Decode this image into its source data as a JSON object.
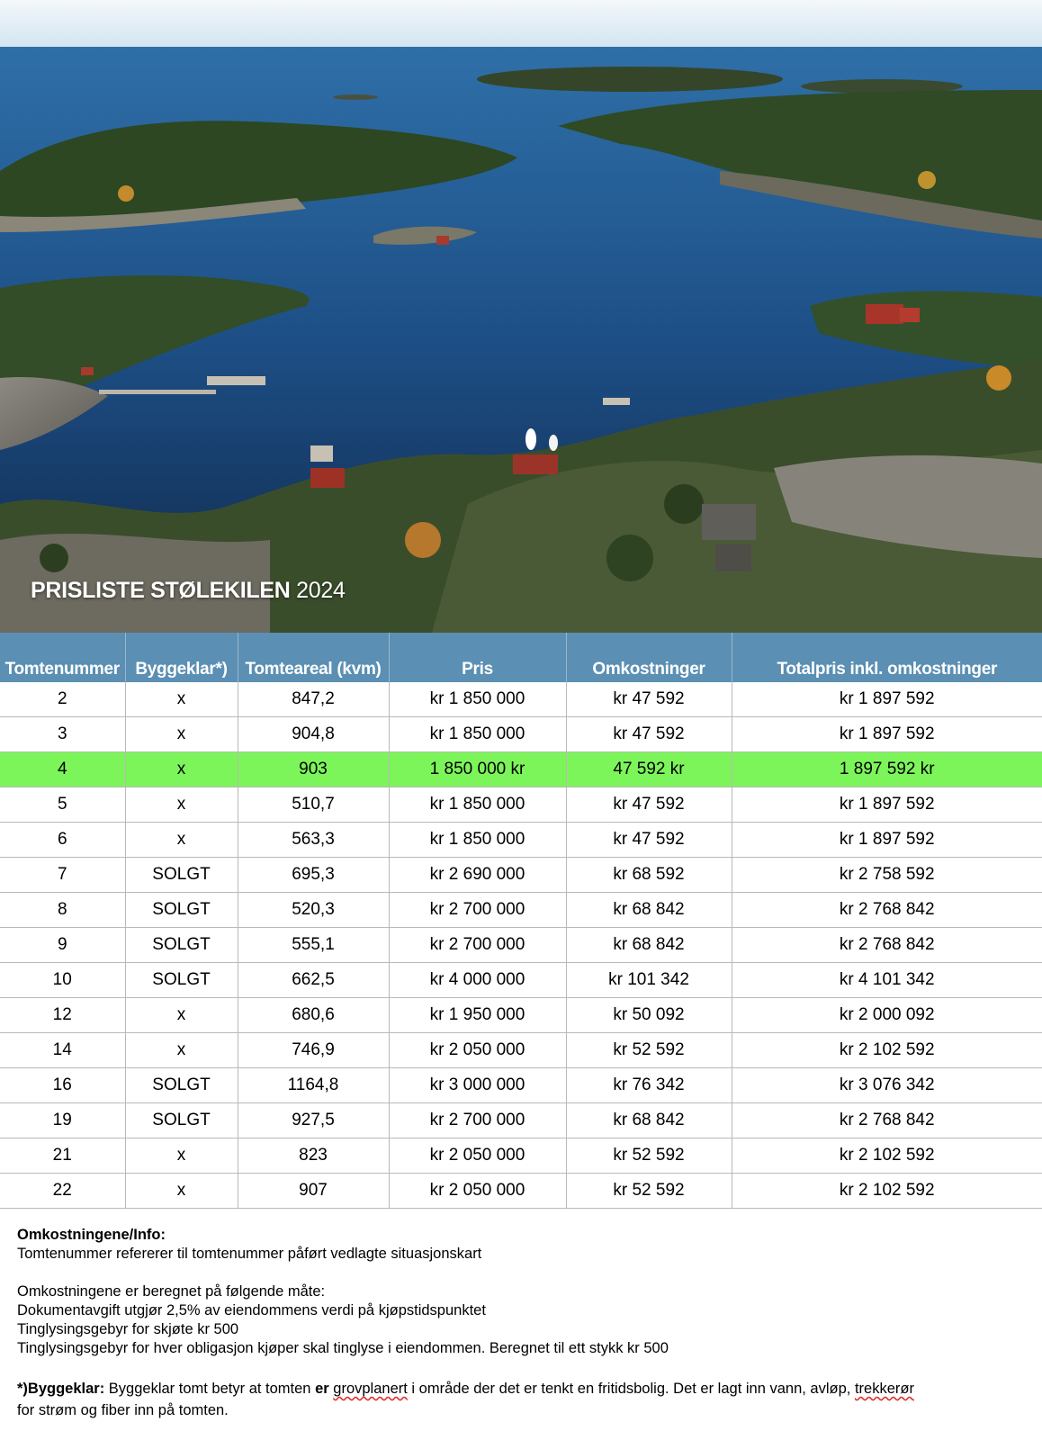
{
  "hero": {
    "title_bold": "PRISLISTE STØLEKILEN",
    "title_year": "2024"
  },
  "table": {
    "headers": [
      "Tomtenummer",
      "Byggeklar*)",
      "Tomteareal (kvm)",
      "Pris",
      "Omkostninger",
      "Totalpris inkl. omkostninger"
    ],
    "rows": [
      [
        "2",
        "x",
        "847,2",
        "kr 1 850 000",
        "kr 47 592",
        "kr 1 897 592"
      ],
      [
        "3",
        "x",
        "904,8",
        "kr 1 850 000",
        "kr 47 592",
        "kr 1 897 592"
      ],
      [
        "4",
        "x",
        "903",
        "1 850 000 kr",
        "47 592 kr",
        "1 897 592 kr"
      ],
      [
        "5",
        "x",
        "510,7",
        "kr 1 850 000",
        "kr 47 592",
        "kr 1 897 592"
      ],
      [
        "6",
        "x",
        "563,3",
        "kr 1 850 000",
        "kr 47 592",
        "kr 1 897 592"
      ],
      [
        "7",
        "SOLGT",
        "695,3",
        "kr 2 690 000",
        "kr 68 592",
        "kr 2 758 592"
      ],
      [
        "8",
        "SOLGT",
        "520,3",
        "kr 2 700 000",
        "kr 68 842",
        "kr 2 768 842"
      ],
      [
        "9",
        "SOLGT",
        "555,1",
        "kr 2 700 000",
        "kr 68 842",
        "kr 2 768 842"
      ],
      [
        "10",
        "SOLGT",
        "662,5",
        "kr 4 000 000",
        "kr 101 342",
        "kr 4 101 342"
      ],
      [
        "12",
        "x",
        "680,6",
        "kr 1 950 000",
        "kr 50 092",
        "kr 2 000 092"
      ],
      [
        "14",
        "x",
        "746,9",
        "kr 2 050 000",
        "kr 52 592",
        "kr 2 102 592"
      ],
      [
        "16",
        "SOLGT",
        "1164,8",
        "kr 3 000 000",
        "kr 76 342",
        "kr 3 076 342"
      ],
      [
        "19",
        "SOLGT",
        "927,5",
        "kr 2 700 000",
        "kr 68 842",
        "kr 2 768 842"
      ],
      [
        "21",
        "x",
        "823",
        "kr 2 050 000",
        "kr 52 592",
        "kr 2 102 592"
      ],
      [
        "22",
        "x",
        "907",
        "kr 2 050 000",
        "kr 52 592",
        "kr 2 102 592"
      ]
    ],
    "highlight_row": 2,
    "colors": {
      "header_bg": "#5b8fb3",
      "highlight_bg": "#7cf55a"
    }
  },
  "notes": {
    "heading": "Omkostningene/Info:",
    "line1": "Tomtenummer refererer til tomtenummer påført vedlagte situasjonskart",
    "calc_intro": "Omkostningene er beregnet på følgende måte:",
    "calc_lines": [
      "Dokumentavgift utgjør 2,5% av eiendommens verdi på kjøpstidspunktet",
      "Tinglysingsgebyr for skjøte kr 500",
      "Tinglysingsgebyr for hver obligasjon kjøper skal tinglyse i eiendommen. Beregnet til ett stykk kr 500"
    ],
    "byggeklar_label": "*)Byggeklar:",
    "byggeklar_a": "Byggeklar tomt betyr at tomten ",
    "byggeklar_er": "er",
    "byggeklar_b": " ",
    "byggeklar_grov": "grovplanert",
    "byggeklar_c": " i område der det er tenkt en fritidsbolig. Det er lagt inn vann, avløp, ",
    "byggeklar_trekk": "trekkerør",
    "byggeklar_line2": "for strøm og fiber inn på tomten."
  }
}
